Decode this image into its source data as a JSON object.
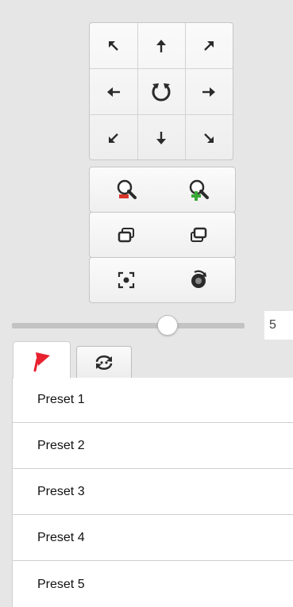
{
  "ptz": {
    "directions": [
      {
        "name": "pan-up-left-icon",
        "glyph": "⇖"
      },
      {
        "name": "pan-up-icon",
        "glyph": "🡑"
      },
      {
        "name": "pan-up-right-icon",
        "glyph": "⇗"
      },
      {
        "name": "pan-left-icon",
        "glyph": "🡐"
      },
      {
        "name": "auto-rotate-icon",
        "glyph": "↻"
      },
      {
        "name": "pan-right-icon",
        "glyph": "🡒"
      },
      {
        "name": "pan-down-left-icon",
        "glyph": "⇙"
      },
      {
        "name": "pan-down-icon",
        "glyph": "🡓"
      },
      {
        "name": "pan-down-right-icon",
        "glyph": "⇘"
      }
    ]
  },
  "speed": {
    "value": "5",
    "fraction": 0.67
  },
  "tabs": [
    {
      "name": "preset-tab",
      "icon": "flag-icon",
      "active": true
    },
    {
      "name": "patrol-tab",
      "icon": "patrol-icon",
      "active": false
    }
  ],
  "presets": [
    "Preset 1",
    "Preset 2",
    "Preset 3",
    "Preset 4",
    "Preset 5"
  ],
  "colors": {
    "flag": "#e8212f",
    "zoom_out": "#d9352c",
    "zoom_in": "#3aa935",
    "icon": "#2b2b2b"
  }
}
